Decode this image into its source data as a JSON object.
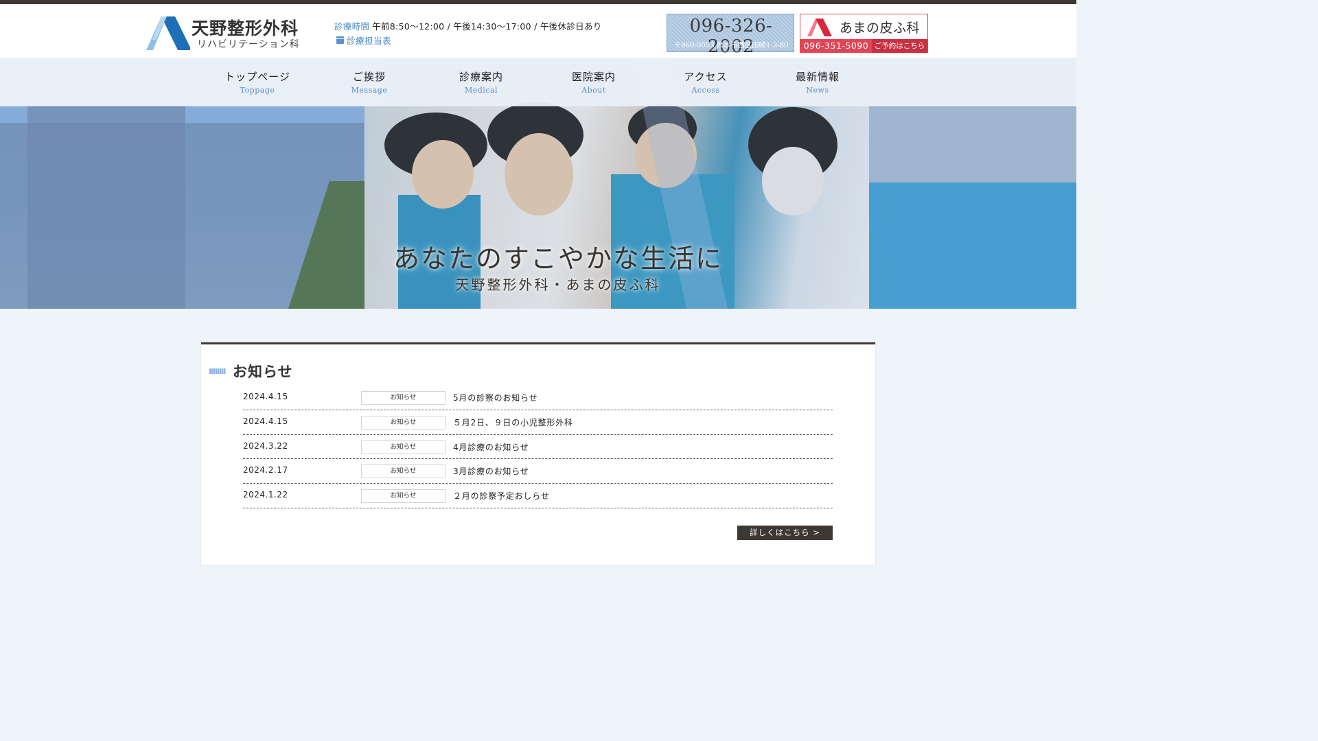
{
  "header": {
    "logo_name": "天野整形外科",
    "logo_sub": "リハビリテーション科",
    "hours_label": "診療時間",
    "hours_text": "午前8:50～12:00 / 午後14:30～17:00 / 午後休診日あり",
    "schedule_link": "診療担当表",
    "tel": "096-326-2002",
    "address": "〒860-0053 熊本市西区田崎1-3-80",
    "skin_name": "あまの皮ふ科",
    "skin_tel": "096-351-5090",
    "skin_reserve": "ご予約はこちら"
  },
  "nav": [
    {
      "jp": "トップページ",
      "en": "Toppage"
    },
    {
      "jp": "ご挨拶",
      "en": "Message"
    },
    {
      "jp": "診療案内",
      "en": "Medical"
    },
    {
      "jp": "医院案内",
      "en": "About"
    },
    {
      "jp": "アクセス",
      "en": "Access"
    },
    {
      "jp": "最新情報",
      "en": "News"
    }
  ],
  "hero": {
    "title": "あなたのすこやかな生活に",
    "subtitle": "天野整形外科・あまの皮ふ科"
  },
  "news": {
    "heading": "お知らせ",
    "items": [
      {
        "date": "2024.4.15",
        "tag": "お知らせ",
        "title": "5月の診察のお知らせ"
      },
      {
        "date": "2024.4.15",
        "tag": "お知らせ",
        "title": "５月2日、９日の小児整形外科"
      },
      {
        "date": "2024.3.22",
        "tag": "お知らせ",
        "title": "4月診療のお知らせ"
      },
      {
        "date": "2024.2.17",
        "tag": "お知らせ",
        "title": "3月診療のお知らせ"
      },
      {
        "date": "2024.1.22",
        "tag": "お知らせ",
        "title": "２月の診察予定おしらせ"
      }
    ],
    "more_label": "詳しくはこちら >"
  },
  "colors": {
    "accent_blue": "#4a8ac4",
    "skin_red": "#e04656",
    "dark": "#3d3833",
    "page_bg": "#eff3fa"
  }
}
